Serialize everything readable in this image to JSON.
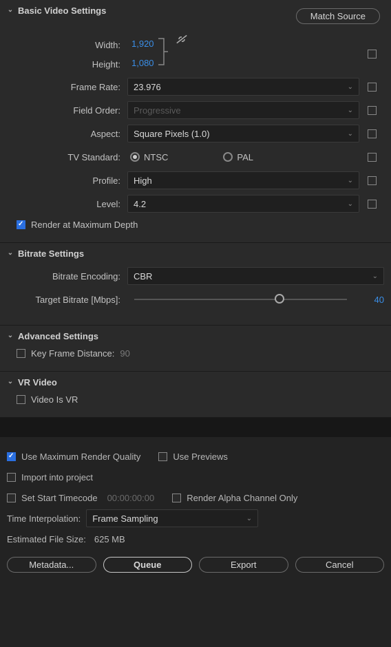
{
  "basic": {
    "title": "Basic Video Settings",
    "match_source": "Match Source",
    "width_label": "Width:",
    "width": "1,920",
    "height_label": "Height:",
    "height": "1,080",
    "frame_rate_label": "Frame Rate:",
    "frame_rate": "23.976",
    "field_order_label": "Field Order:",
    "field_order": "Progressive",
    "aspect_label": "Aspect:",
    "aspect": "Square Pixels (1.0)",
    "tv_standard_label": "TV Standard:",
    "ntsc": "NTSC",
    "pal": "PAL",
    "profile_label": "Profile:",
    "profile": "High",
    "level_label": "Level:",
    "level": "4.2",
    "render_max_depth": "Render at Maximum Depth"
  },
  "bitrate": {
    "title": "Bitrate Settings",
    "encoding_label": "Bitrate Encoding:",
    "encoding": "CBR",
    "target_label": "Target Bitrate [Mbps]:",
    "target_value": "40"
  },
  "advanced": {
    "title": "Advanced Settings",
    "keyframe_label": "Key Frame Distance:",
    "keyframe_value": "90"
  },
  "vr": {
    "title": "VR Video",
    "is_vr": "Video Is VR"
  },
  "bottom": {
    "max_quality": "Use Maximum Render Quality",
    "use_previews": "Use Previews",
    "import_project": "Import into project",
    "set_start_tc": "Set Start Timecode",
    "start_tc_value": "00:00:00:00",
    "render_alpha": "Render Alpha Channel Only",
    "time_interp_label": "Time Interpolation:",
    "time_interp": "Frame Sampling",
    "est_size_label": "Estimated File Size:",
    "est_size": "625 MB",
    "metadata": "Metadata...",
    "queue": "Queue",
    "export": "Export",
    "cancel": "Cancel"
  }
}
